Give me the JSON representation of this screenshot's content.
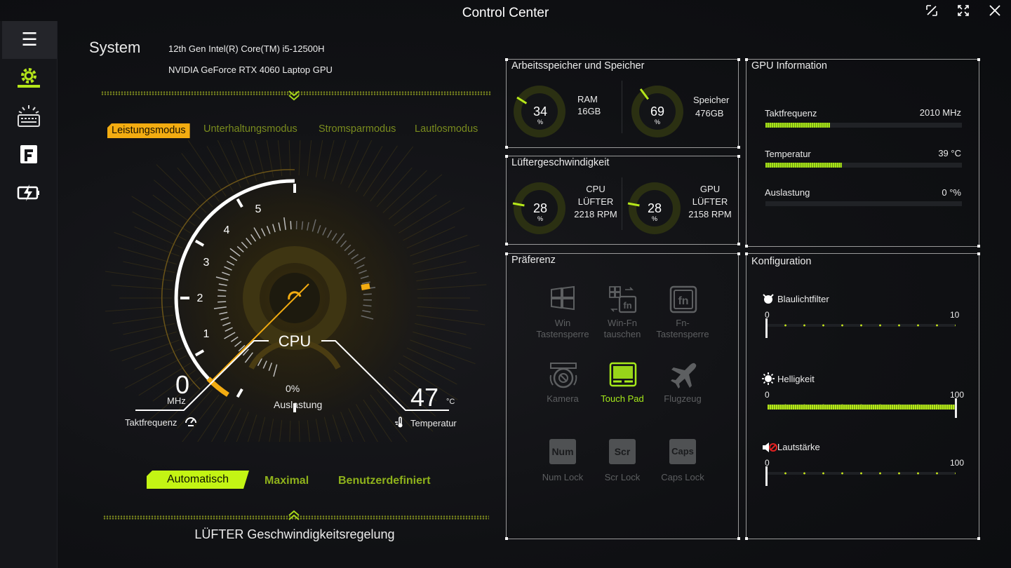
{
  "window": {
    "title": "Control Center"
  },
  "system": {
    "title": "System",
    "cpu_name": "12th Gen Intel(R) Core(TM) i5-12500H",
    "gpu_name": "NVIDIA GeForce RTX 4060 Laptop GPU"
  },
  "modes": [
    {
      "label": "Leistungsmodus",
      "active": true
    },
    {
      "label": "Unterhaltungsmodus",
      "active": false
    },
    {
      "label": "Stromsparmodus",
      "active": false
    },
    {
      "label": "Lautlosmodus",
      "active": false
    }
  ],
  "cpu_gauge": {
    "label": "CPU",
    "ticks": [
      "1",
      "2",
      "3",
      "4",
      "5"
    ],
    "frequency_value": "0",
    "frequency_unit": "MHz",
    "frequency_label": "Taktfrequenz",
    "load_value": "0%",
    "load_label": "Auslastung",
    "temperature_value": "47",
    "temperature_unit": "°C",
    "temperature_label": "Temperatur"
  },
  "fan_modes": [
    {
      "label": "Automatisch",
      "active": true
    },
    {
      "label": "Maximal",
      "active": false
    },
    {
      "label": "Benutzerdefiniert",
      "active": false
    }
  ],
  "footer": {
    "label": "LÜFTER Geschwindigkeitsregelung"
  },
  "memory_panel": {
    "title": "Arbeitsspeicher und Speicher",
    "ram": {
      "value": "34",
      "unit": "%",
      "name": "RAM",
      "size": "16GB",
      "percent": 34
    },
    "storage": {
      "value": "69",
      "unit": "%",
      "name": "Speicher",
      "size": "476GB",
      "percent": 69
    }
  },
  "fan_panel": {
    "title": "Lüftergeschwindigkeit",
    "cpu_fan": {
      "value": "28",
      "unit": "%",
      "line1": "CPU",
      "line2": "LÜFTER",
      "rpm": "2218 RPM",
      "percent": 28
    },
    "gpu_fan": {
      "value": "28",
      "unit": "%",
      "line1": "GPU",
      "line2": "LÜFTER",
      "rpm": "2158 RPM",
      "percent": 28
    }
  },
  "gpu_panel": {
    "title": "GPU Information",
    "clock": {
      "label": "Taktfrequenz",
      "value": "2010 MHz",
      "fill": 0.33
    },
    "temperature": {
      "label": "Temperatur",
      "value": "39 °C",
      "fill": 0.39
    },
    "load": {
      "label": "Auslastung",
      "value": "0 °%",
      "fill": 0
    }
  },
  "preference_panel": {
    "title": "Präferenz",
    "items": [
      {
        "line1": "Win",
        "line2": "Tastensperre",
        "icon": "windows-icon",
        "active": false
      },
      {
        "line1": "Win-Fn",
        "line2": "tauschen",
        "icon": "win-fn-swap-icon",
        "active": false
      },
      {
        "line1": "Fn-",
        "line2": "Tastensperre",
        "icon": "fn-lock-icon",
        "active": false
      },
      {
        "line1": "Kamera",
        "line2": "",
        "icon": "camera-icon",
        "active": false
      },
      {
        "line1": "Touch Pad",
        "line2": "",
        "icon": "touchpad-icon",
        "active": true
      },
      {
        "line1": "Flugzeug",
        "line2": "",
        "icon": "airplane-icon",
        "active": false
      },
      {
        "line1": "Num Lock",
        "line2": "",
        "key": "Num",
        "icon": "num-lock-icon",
        "active": false
      },
      {
        "line1": "Scr Lock",
        "line2": "",
        "key": "Scr",
        "icon": "scroll-lock-icon",
        "active": false
      },
      {
        "line1": "Caps Lock",
        "line2": "",
        "key": "Caps",
        "icon": "caps-lock-icon",
        "active": false
      }
    ]
  },
  "config_panel": {
    "title": "Konfiguration",
    "blue_light": {
      "label": "Blaulichtfilter",
      "min": "0",
      "max": "10",
      "level": 0
    },
    "brightness": {
      "label": "Helligkeit",
      "min": "0",
      "max": "100",
      "level": 1.0
    },
    "volume": {
      "label": "Lautstärke",
      "min": "0",
      "max": "100",
      "level": 0
    }
  },
  "colors": {
    "accent_green": "#c3f414",
    "accent_orange": "#f3ac11",
    "mode_inactive": "#7a8c1e"
  }
}
